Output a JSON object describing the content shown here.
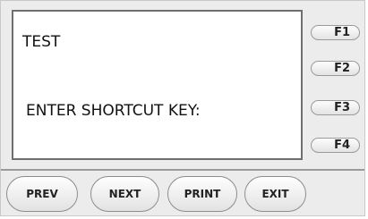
{
  "display": {
    "line1": "TEST",
    "line3": "ENTER SHORTCUT KEY:"
  },
  "function_keys": {
    "f1": "F1",
    "f2": "F2",
    "f3": "F3",
    "f4": "F4"
  },
  "nav_buttons": {
    "prev": "PREV",
    "next": "NEXT",
    "print": "PRINT",
    "exit": "EXIT"
  }
}
